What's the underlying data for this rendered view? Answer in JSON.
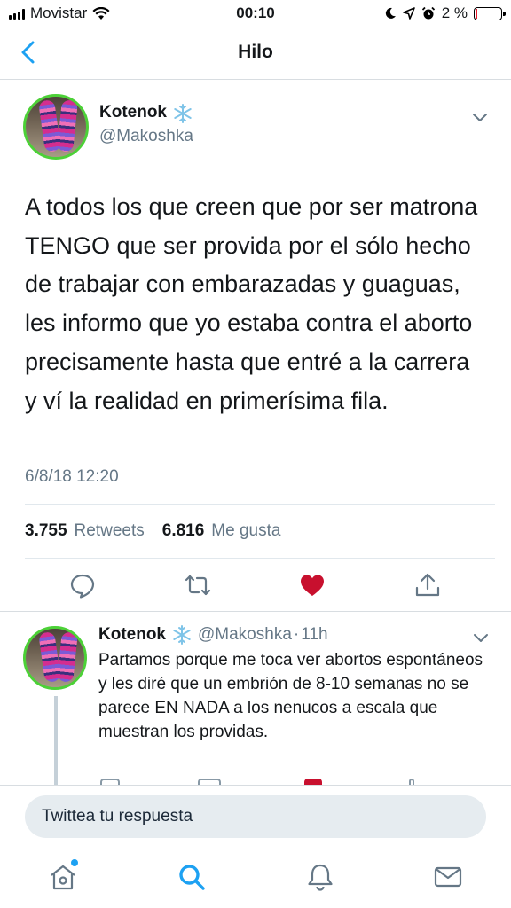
{
  "status_bar": {
    "carrier": "Movistar",
    "time": "00:10",
    "battery": "2 %"
  },
  "nav": {
    "title": "Hilo"
  },
  "main_tweet": {
    "author_name": "Kotenok",
    "handle": "@Makoshka",
    "text": "A todos los que creen que por ser matrona TENGO que ser provida por el sólo hecho de trabajar con embarazadas y guaguas, les informo que yo estaba contra el aborto precisamente hasta que entré a la carrera y ví la realidad en primerísima fila.",
    "timestamp": "6/8/18 12:20",
    "retweets_count": "3.755",
    "retweets_label": "Retweets",
    "likes_count": "6.816",
    "likes_label": "Me gusta",
    "liked": true
  },
  "reply_tweet": {
    "author_name": "Kotenok",
    "handle": "@Makoshka",
    "separator": "·",
    "time_ago": "11h",
    "text": "Partamos porque me toca ver abortos espontáneos y les diré que un embrión de 8-10 semanas no se parece EN NADA a los nenucos a escala que muestran los providas."
  },
  "composer": {
    "placeholder": "Twittea tu respuesta"
  },
  "tab_bar": {
    "tabs": [
      "home-icon",
      "search-icon",
      "notifications-icon",
      "messages-icon"
    ],
    "active": "search-icon"
  },
  "colors": {
    "accent": "#1da1f2",
    "like": "#e0245e",
    "heart_filled": "#c8102e",
    "avatar_ring": "#4cd137",
    "muted": "#657786"
  }
}
